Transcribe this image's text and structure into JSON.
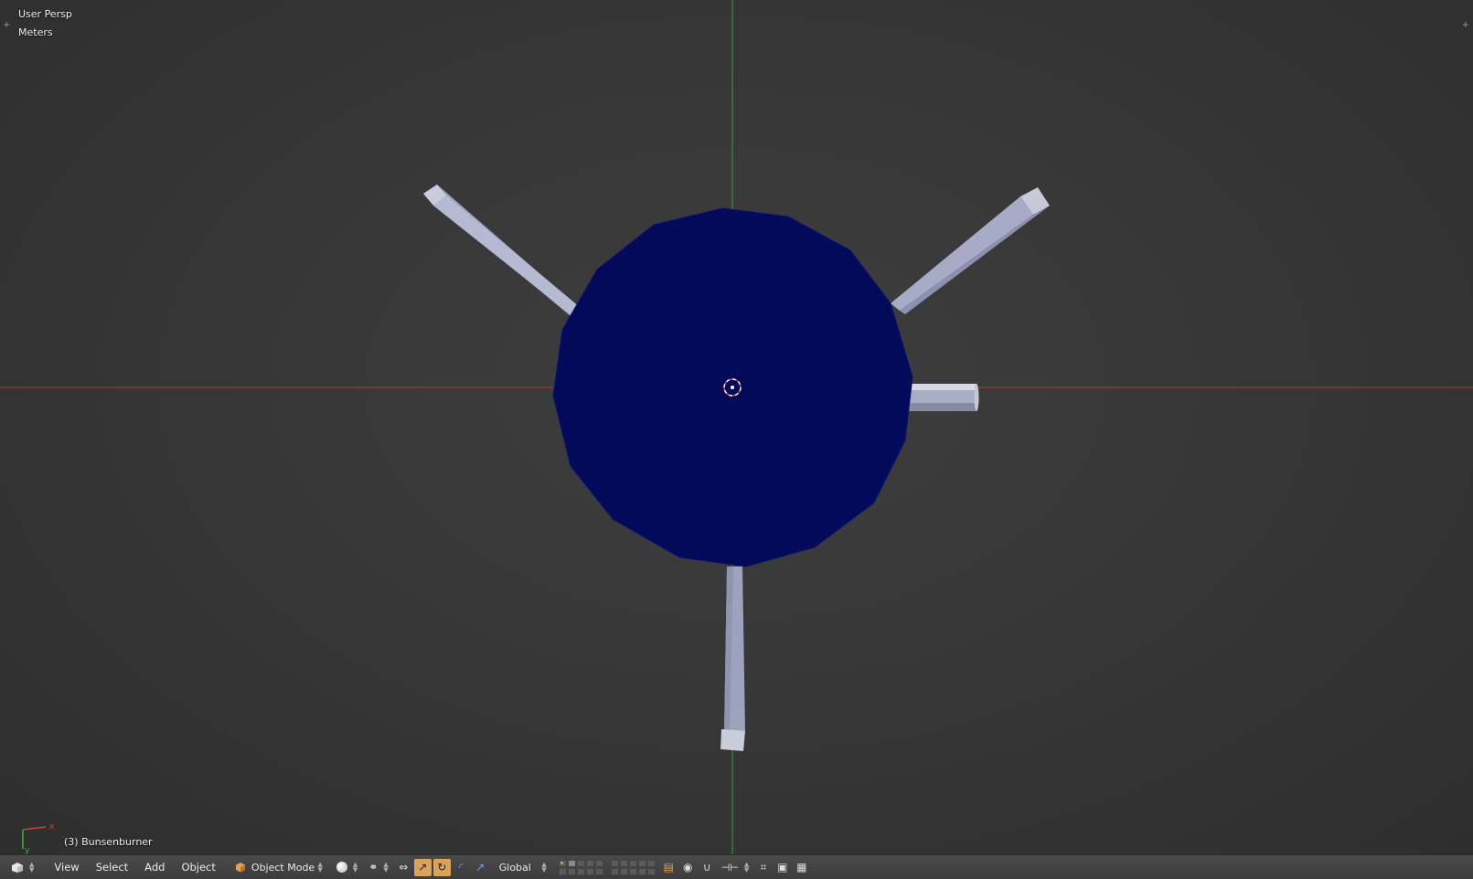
{
  "viewport": {
    "view_name": "User Persp",
    "units": "Meters",
    "active_object": "(3) Bunsenburner",
    "axis_labels": {
      "x": "x",
      "y": "y"
    },
    "colors": {
      "x_axis": "#a33a3a",
      "y_axis": "#3c9a3c",
      "object_body": "#030a5a",
      "object_legs": "#b9bdd6"
    }
  },
  "header": {
    "editor_type_icon": "3d-view-icon",
    "menus": [
      "View",
      "Select",
      "Add",
      "Object"
    ],
    "mode": "Object Mode",
    "shading_icon": "solid-shading-icon",
    "transform_orientation": "Global"
  }
}
